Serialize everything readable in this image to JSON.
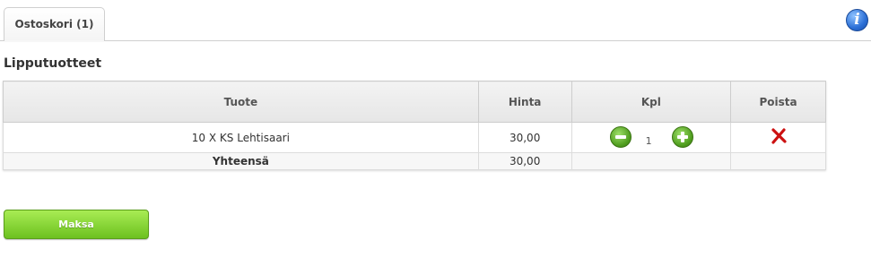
{
  "tabs": [
    {
      "label": "Ostoskori (1)"
    }
  ],
  "section_title": "Lipputuotteet",
  "table": {
    "headers": {
      "product": "Tuote",
      "price": "Hinta",
      "quantity": "Kpl",
      "remove": "Poista"
    },
    "rows": [
      {
        "product": "10 X KS Lehtisaari",
        "price": "30,00",
        "quantity": "1"
      }
    ],
    "total": {
      "label": "Yhteensä",
      "value": "30,00"
    }
  },
  "buttons": {
    "pay": "Maksa"
  },
  "icons": {
    "info": "info-icon",
    "decrease": "minus-circle-icon",
    "increase": "plus-circle-icon",
    "remove": "red-x-icon"
  },
  "colors": {
    "accent_green": "#6cc11f",
    "remove_red": "#cc1111",
    "info_blue": "#2b6fd6"
  }
}
